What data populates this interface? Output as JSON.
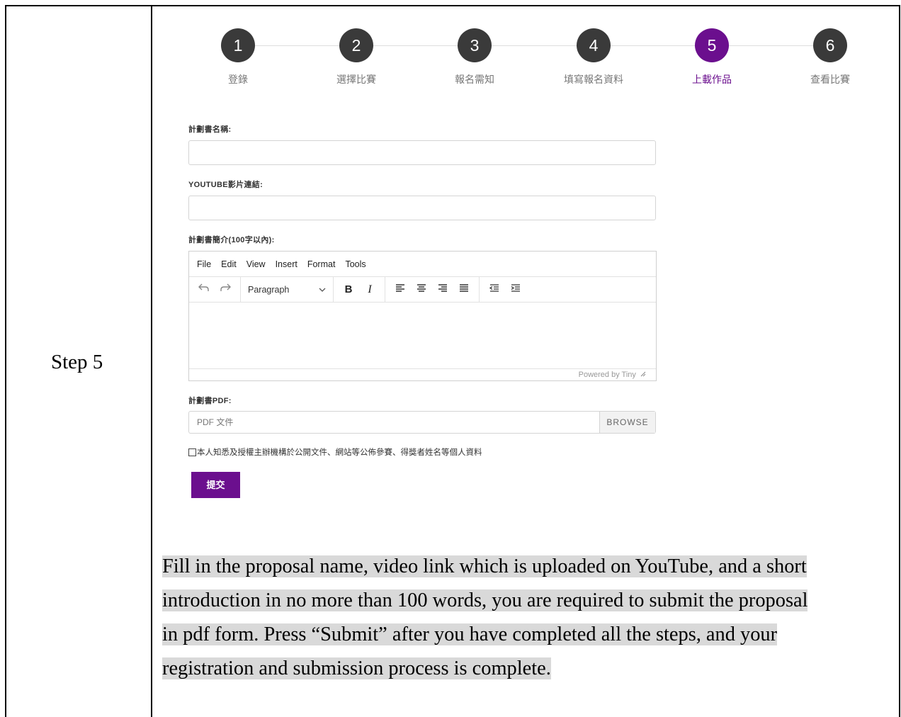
{
  "row_label": "Step 5",
  "stepper": {
    "steps": [
      {
        "num": "1",
        "label": "登錄"
      },
      {
        "num": "2",
        "label": "選擇比賽"
      },
      {
        "num": "3",
        "label": "報名需知"
      },
      {
        "num": "4",
        "label": "填寫報名資料"
      },
      {
        "num": "5",
        "label": "上載作品"
      },
      {
        "num": "6",
        "label": "查看比賽"
      }
    ],
    "active_index": 4,
    "active_color": "#6b0f8e"
  },
  "form": {
    "proposal_name_label": "計劃書名稱:",
    "youtube_label": "YOUTUBE影片連結:",
    "intro_label": "計劃書簡介(100字以內):",
    "editor": {
      "menu": [
        "File",
        "Edit",
        "View",
        "Insert",
        "Format",
        "Tools"
      ],
      "paragraph_select": "Paragraph",
      "bold": "B",
      "italic": "I",
      "powered_by": "Powered by Tiny"
    },
    "pdf_label": "計劃書PDF:",
    "pdf_placeholder": "PDF 文件",
    "browse_label": "BROWSE",
    "consent_text": "本人知悉及授權主辦機構於公開文件、網站等公佈參賽、得獎者姓名等個人資料",
    "submit_label": "提交"
  },
  "description": [
    "Fill in the proposal name, video link which is uploaded on YouTube, and a short",
    "introduction in no more than 100 words, you are required to submit the proposal",
    "in pdf form. Press “Submit” after you have completed all the steps, and your",
    "registration and submission process is complete."
  ]
}
